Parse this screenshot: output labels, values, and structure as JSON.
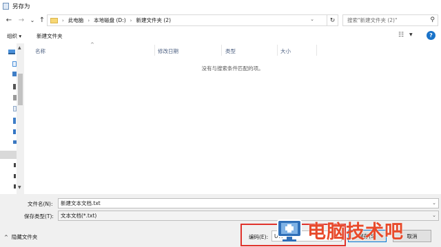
{
  "window": {
    "title": "另存为"
  },
  "nav": {
    "back": "←",
    "forward": "→",
    "recent": "⌄",
    "up": "↑"
  },
  "address": {
    "crumbs": [
      "此电脑",
      "本地磁盘 (D:)",
      "新建文件夹 (2)"
    ],
    "refresh": "↻"
  },
  "search": {
    "placeholder": "搜索\"新建文件夹 (2)\""
  },
  "toolbar": {
    "organize_label": "组织 ▾",
    "new_folder_label": "新建文件夹"
  },
  "columns": [
    "名称",
    "修改日期",
    "类型",
    "大小"
  ],
  "empty_message": "没有与搜索条件匹配的项。",
  "form": {
    "filename_label": "文件名(N):",
    "filename_value": "新建文本文档.txt",
    "savetype_label": "保存类型(T):",
    "savetype_value": "文本文档(*.txt)",
    "hide_folders_label": "隐藏文件夹",
    "encoding_label": "编码(E):",
    "encoding_value": "UTF-8",
    "save_label": "保存(S)",
    "cancel_label": "取消"
  },
  "watermark": {
    "text": "电脑技术吧"
  },
  "colors": {
    "accent": "#0078d7",
    "highlight_box": "#e0322b",
    "watermark": "#e84a2b"
  }
}
